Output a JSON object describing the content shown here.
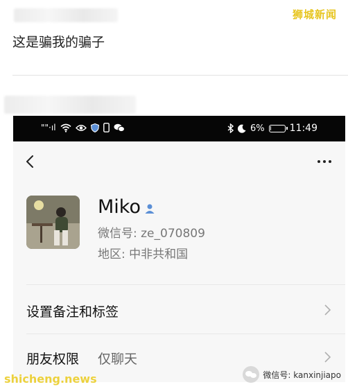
{
  "post": {
    "watermark": "狮城新闻",
    "text": "这是骗我的骗子"
  },
  "statusbar": {
    "signal_text": "\"\"·ıl",
    "battery_percent": "6%",
    "battery_level": 0.06,
    "time": "11:49"
  },
  "profile": {
    "name": "Miko",
    "wechat_id": "微信号:  ze_070809",
    "region": "地区:  中非共和国"
  },
  "rows": {
    "remark": {
      "label": "设置备注和标签"
    },
    "permission": {
      "label": "朋友权限",
      "value": "仅聊天"
    }
  },
  "footer": {
    "left_watermark": "shicheng.news",
    "right_watermark": "微信号: kanxinjiapo"
  },
  "colors": {
    "accent_blue": "#5b8fd6",
    "watermark_yellow": "#e7c51f"
  }
}
